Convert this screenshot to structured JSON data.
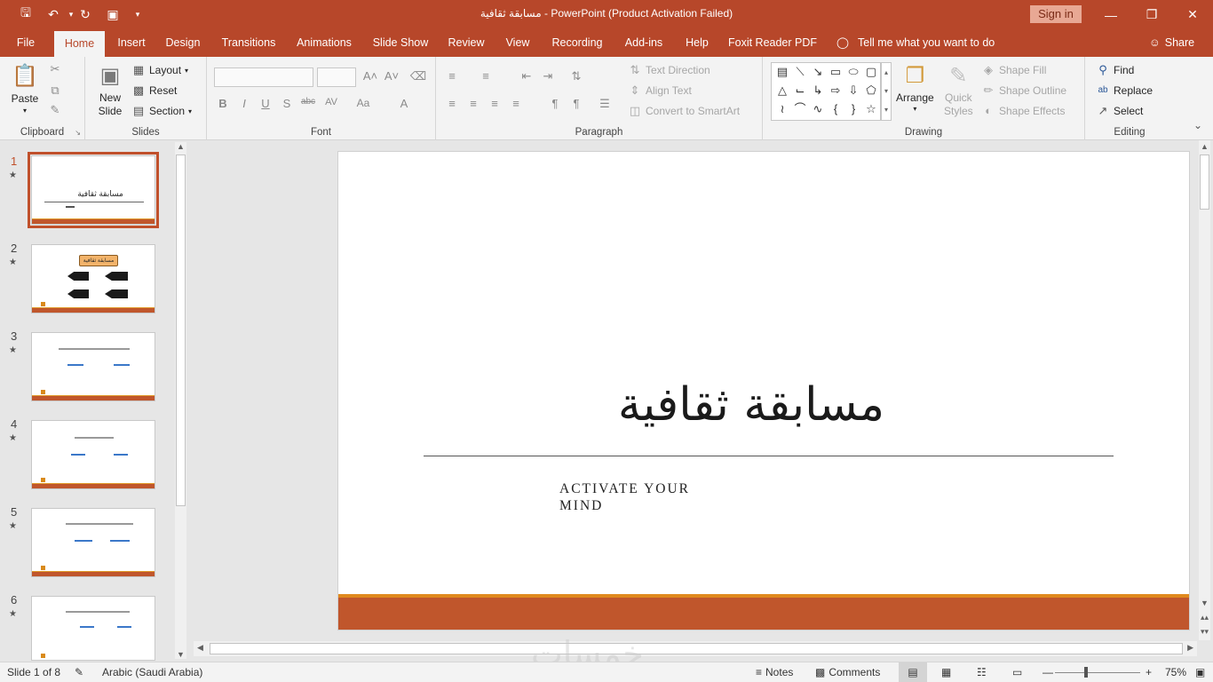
{
  "titlebar": {
    "title": "مسابقة ثقافية  -  PowerPoint (Product Activation Failed)",
    "sign_in": "Sign in"
  },
  "tabs": [
    "File",
    "Home",
    "Insert",
    "Design",
    "Transitions",
    "Animations",
    "Slide Show",
    "Review",
    "View",
    "Recording",
    "Add-ins",
    "Help",
    "Foxit Reader PDF"
  ],
  "tell_me": "Tell me what you want to do",
  "share": "Share",
  "ribbon": {
    "clipboard": {
      "label": "Clipboard",
      "paste": "Paste"
    },
    "slides": {
      "label": "Slides",
      "new_slide_1": "New",
      "new_slide_2": "Slide",
      "layout": "Layout",
      "reset": "Reset",
      "section": "Section"
    },
    "font": {
      "label": "Font"
    },
    "paragraph": {
      "label": "Paragraph",
      "text_direction": "Text Direction",
      "align_text": "Align Text",
      "convert_smartart": "Convert to SmartArt"
    },
    "drawing": {
      "label": "Drawing",
      "arrange": "Arrange",
      "quick_styles_1": "Quick",
      "quick_styles_2": "Styles",
      "shape_fill": "Shape Fill",
      "shape_outline": "Shape Outline",
      "shape_effects": "Shape Effects"
    },
    "editing": {
      "label": "Editing",
      "find": "Find",
      "replace": "Replace",
      "select": "Select"
    }
  },
  "thumbnails": [
    {
      "num": "1",
      "title": "مسابقة ثقافية"
    },
    {
      "num": "2",
      "title": "مسابقة ثقافية"
    },
    {
      "num": "3",
      "title": ""
    },
    {
      "num": "4",
      "title": ""
    },
    {
      "num": "5",
      "title": ""
    },
    {
      "num": "6",
      "title": ""
    }
  ],
  "slide": {
    "title": "مسابقة ثقافية",
    "subtitle_1": "ACTIVATE YOUR",
    "subtitle_2": "MIND"
  },
  "status": {
    "slide_of": "Slide 1 of 8",
    "language": "Arabic (Saudi Arabia)",
    "notes": "Notes",
    "comments": "Comments",
    "zoom": "75%"
  },
  "watermark": "خمسات",
  "colors": {
    "accent": "#b7472a",
    "slide_band": "#c0562c",
    "slide_band_top": "#e08a1e"
  }
}
